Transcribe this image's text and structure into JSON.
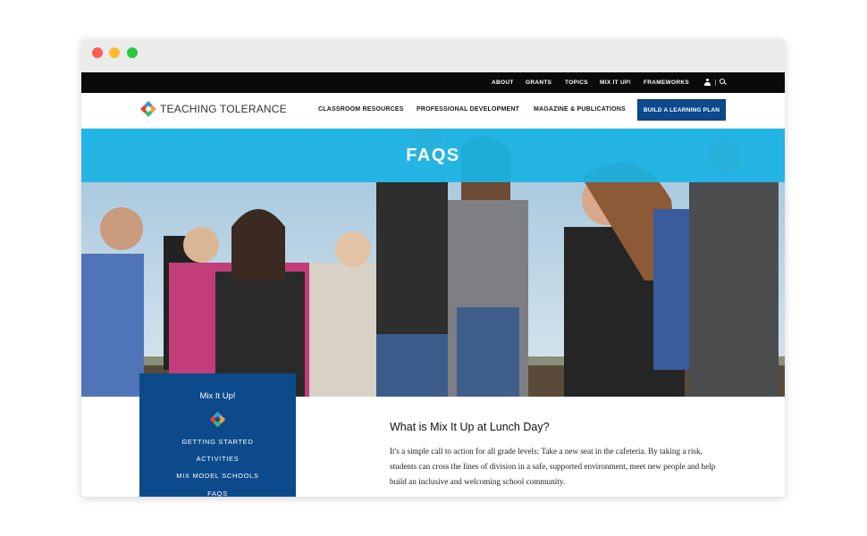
{
  "utility_nav": [
    "ABOUT",
    "GRANTS",
    "TOPICS",
    "MIX IT UP!",
    "FRAMEWORKS"
  ],
  "logo_text": "TEACHING TOLERANCE",
  "main_nav": {
    "items": [
      "CLASSROOM RESOURCES",
      "PROFESSIONAL DEVELOPMENT",
      "MAGAZINE & PUBLICATIONS"
    ],
    "cta": "BUILD A LEARNING PLAN"
  },
  "hero": {
    "title": "FAQS"
  },
  "sidebar": {
    "title": "Mix It Up!",
    "links": [
      "GETTING STARTED",
      "ACTIVITIES",
      "MIX MODEL SCHOOLS",
      "FAQS"
    ]
  },
  "content": {
    "heading": "What is Mix It Up at Lunch Day?",
    "paragraph": "It's a simple call to action for all grade levels: Take a new seat in the cafeteria. By taking a risk, students can cross the lines of division in a safe, supported environment, meet new people and help build an inclusive and welcoming school community."
  },
  "colors": {
    "hero_band": "#1ab4e4",
    "brand_blue": "#0c4a8c",
    "utility_bar": "#0a0a0a"
  },
  "icons": [
    "user-icon",
    "search-icon",
    "logo-diamond-icon"
  ]
}
